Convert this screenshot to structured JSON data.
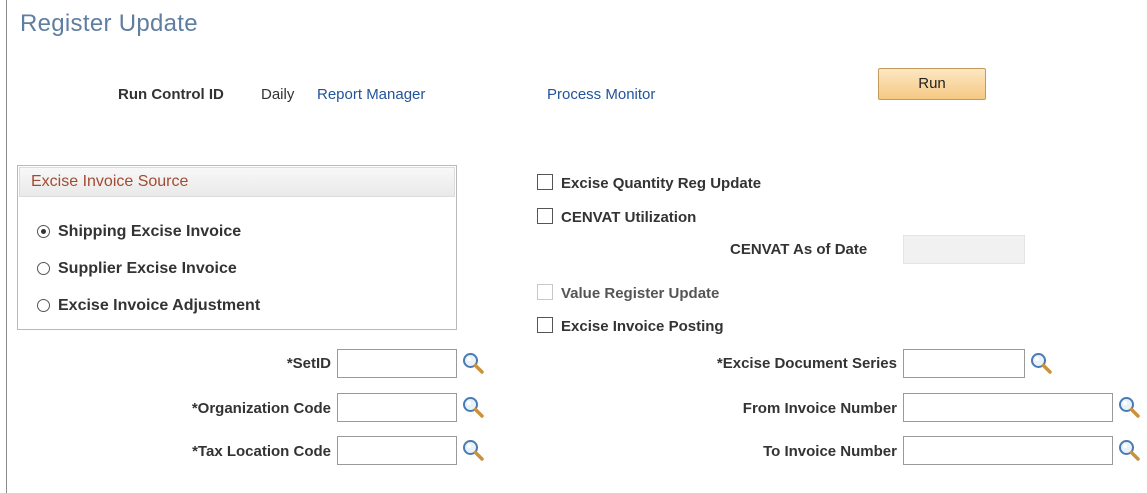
{
  "page": {
    "title": "Register Update"
  },
  "run_control": {
    "label": "Run Control ID",
    "value": "Daily",
    "report_manager": "Report Manager",
    "process_monitor": "Process Monitor",
    "run_button": "Run"
  },
  "source_group": {
    "title": "Excise Invoice Source",
    "options": [
      {
        "label": "Shipping Excise Invoice",
        "selected": true
      },
      {
        "label": "Supplier Excise Invoice",
        "selected": false
      },
      {
        "label": "Excise Invoice Adjustment",
        "selected": false
      }
    ]
  },
  "options": {
    "excise_qty_reg_update": "Excise Quantity Reg Update",
    "cenvat_utilization": "CENVAT Utilization",
    "cenvat_as_of_date": "CENVAT As of Date",
    "value_register_update": "Value Register Update",
    "excise_invoice_posting": "Excise Invoice Posting"
  },
  "fields_left": {
    "setid": {
      "label": "*SetID",
      "value": ""
    },
    "organization_code": {
      "label": "*Organization Code",
      "value": ""
    },
    "tax_location_code": {
      "label": "*Tax Location Code",
      "value": ""
    }
  },
  "fields_right": {
    "excise_document_series": {
      "label": "*Excise Document Series",
      "value": ""
    },
    "from_invoice_number": {
      "label": "From Invoice Number",
      "value": ""
    },
    "to_invoice_number": {
      "label": "To Invoice Number",
      "value": ""
    }
  },
  "colors": {
    "title": "#5f7ea0",
    "link": "#22549a",
    "group_title": "#a24b33",
    "button_fill": "#f5c983"
  }
}
